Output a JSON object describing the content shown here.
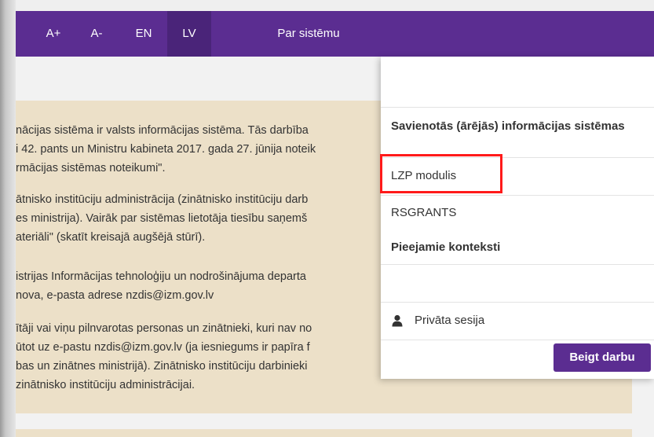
{
  "topnav": {
    "items": [
      {
        "label": "A+"
      },
      {
        "label": "A-"
      },
      {
        "label": "EN"
      },
      {
        "label": "LV"
      },
      {
        "label": "Par sistēmu"
      }
    ]
  },
  "notice": {
    "lines": [
      "nācijas sistēma ir valsts informācijas sistēma. Tās darbība",
      "i 42. pants un Ministru kabineta 2017. gada 27. jūnija noteik",
      "rmācijas sistēmas noteikumi\".",
      "ātnisko institūciju administrācija (zinātnisko institūciju darb",
      "es ministrija). Vairāk par sistēmas lietotāja tiesību saņemš",
      "ateriāli\" (skatīt kreisajā augšējā stūrī).",
      "istrijas Informācijas tehnoloģiju un nodrošinājuma departa",
      "nova, e-pasta adrese nzdis@izm.gov.lv",
      "ītāji vai viņu pilnvarotas personas un zinātnieki, kuri nav no",
      "ūtot uz e-pastu nzdis@izm.gov.lv (ja iesniegums ir papīra f",
      "bas un zinātnes ministrijā). Zinātnisko institūciju darbinieki",
      "zinātnisko institūciju administrācijai."
    ]
  },
  "panel": {
    "section_title": "Savienotās (ārējās) informācijas sistēmas",
    "items": [
      {
        "label": "LZP modulis"
      },
      {
        "label": "RSGRANTS"
      }
    ],
    "contexts_title": "Pieejamie konteksti",
    "private_session": "Privāta sesija",
    "end_button": "Beigt darbu"
  },
  "colors": {
    "brand": "#5b2d91",
    "notice_bg": "#ece0c8",
    "highlight": "#ff1a1a"
  },
  "icons": {
    "private_session": "user-icon"
  }
}
